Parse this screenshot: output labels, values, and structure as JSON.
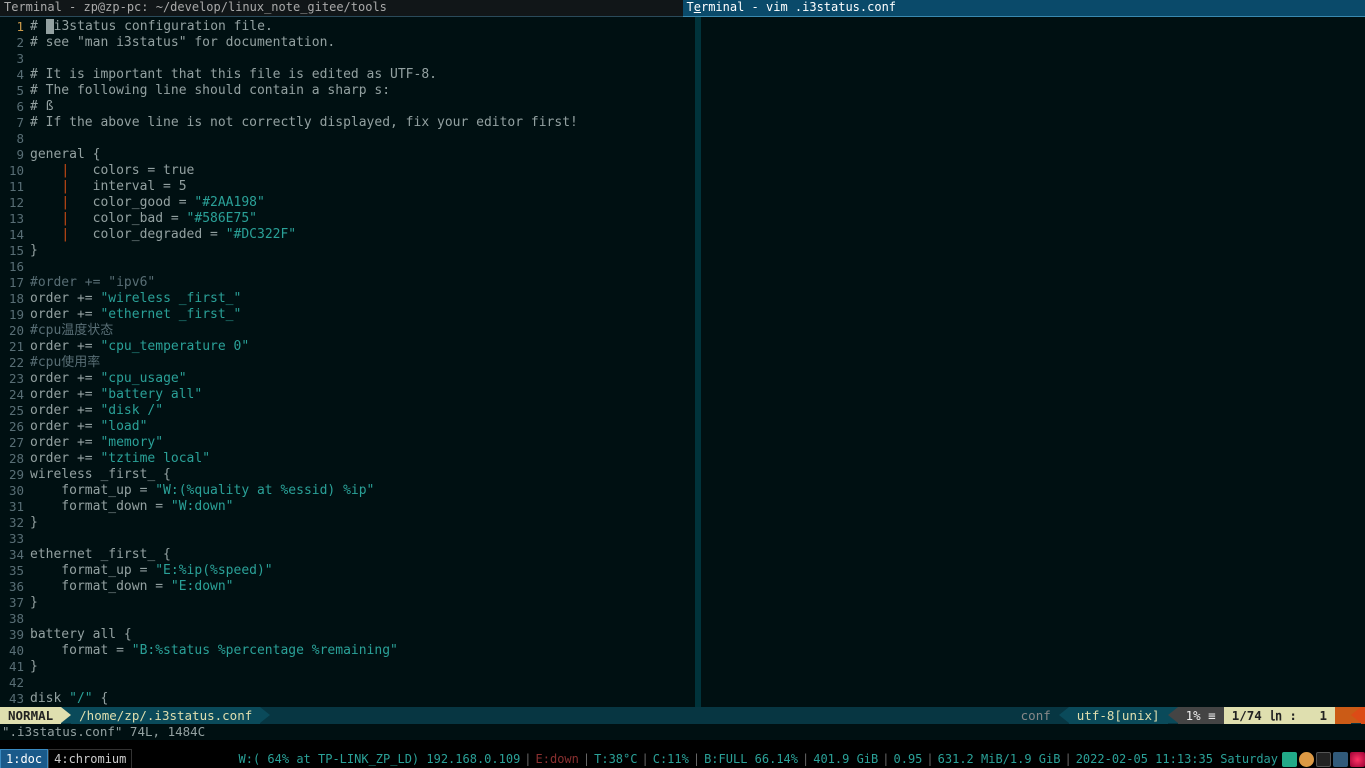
{
  "tabs": {
    "left": "Terminal - zp@zp-pc: ~/develop/linux_note_gitee/tools",
    "right_pre": "T",
    "right_u": "e",
    "right_post": "rminal - vim .i3status.conf"
  },
  "lines": [
    {
      "n": "1",
      "cur": true,
      "segs": [
        {
          "cls": "c-txt",
          "t": "# "
        },
        {
          "cls": "cursor-block",
          "t": ""
        },
        {
          "cls": "c-txt",
          "t": "i3status configuration file."
        }
      ]
    },
    {
      "n": "2",
      "segs": [
        {
          "cls": "c-txt",
          "t": "# see \"man i3status\" for documentation."
        }
      ]
    },
    {
      "n": "3",
      "segs": [
        {
          "cls": "c-txt",
          "t": ""
        }
      ]
    },
    {
      "n": "4",
      "segs": [
        {
          "cls": "c-txt",
          "t": "# It is important that this file is edited as UTF-8."
        }
      ]
    },
    {
      "n": "5",
      "segs": [
        {
          "cls": "c-txt",
          "t": "# The following line should contain a sharp s:"
        }
      ]
    },
    {
      "n": "6",
      "segs": [
        {
          "cls": "c-txt",
          "t": "# ß"
        }
      ]
    },
    {
      "n": "7",
      "segs": [
        {
          "cls": "c-txt",
          "t": "# If the above line is not correctly displayed, fix your editor first!"
        }
      ]
    },
    {
      "n": "8",
      "segs": [
        {
          "cls": "c-txt",
          "t": ""
        }
      ]
    },
    {
      "n": "9",
      "segs": [
        {
          "cls": "c-key",
          "t": "general {"
        }
      ]
    },
    {
      "n": "10",
      "segs": [
        {
          "cls": "c-txt",
          "t": "    "
        },
        {
          "cls": "c-bar",
          "t": "|"
        },
        {
          "cls": "c-txt",
          "t": "   colors = true"
        }
      ]
    },
    {
      "n": "11",
      "segs": [
        {
          "cls": "c-txt",
          "t": "    "
        },
        {
          "cls": "c-bar",
          "t": "|"
        },
        {
          "cls": "c-txt",
          "t": "   interval = 5"
        }
      ]
    },
    {
      "n": "12",
      "segs": [
        {
          "cls": "c-txt",
          "t": "    "
        },
        {
          "cls": "c-bar",
          "t": "|"
        },
        {
          "cls": "c-txt",
          "t": "   color_good = "
        },
        {
          "cls": "c-str",
          "t": "\"#2AA198\""
        }
      ]
    },
    {
      "n": "13",
      "segs": [
        {
          "cls": "c-txt",
          "t": "    "
        },
        {
          "cls": "c-bar",
          "t": "|"
        },
        {
          "cls": "c-txt",
          "t": "   color_bad = "
        },
        {
          "cls": "c-str",
          "t": "\"#586E75\""
        }
      ]
    },
    {
      "n": "14",
      "segs": [
        {
          "cls": "c-txt",
          "t": "    "
        },
        {
          "cls": "c-bar",
          "t": "|"
        },
        {
          "cls": "c-txt",
          "t": "   color_degraded = "
        },
        {
          "cls": "c-str",
          "t": "\"#DC322F\""
        }
      ]
    },
    {
      "n": "15",
      "segs": [
        {
          "cls": "c-key",
          "t": "}"
        }
      ]
    },
    {
      "n": "16",
      "segs": [
        {
          "cls": "c-txt",
          "t": ""
        }
      ]
    },
    {
      "n": "17",
      "segs": [
        {
          "cls": "c-comment",
          "t": "#order += \"ipv6\""
        }
      ]
    },
    {
      "n": "18",
      "segs": [
        {
          "cls": "c-txt",
          "t": "order += "
        },
        {
          "cls": "c-str",
          "t": "\"wireless _first_\""
        }
      ]
    },
    {
      "n": "19",
      "segs": [
        {
          "cls": "c-txt",
          "t": "order += "
        },
        {
          "cls": "c-str",
          "t": "\"ethernet _first_\""
        }
      ]
    },
    {
      "n": "20",
      "segs": [
        {
          "cls": "c-comment",
          "t": "#cpu温度状态"
        }
      ]
    },
    {
      "n": "21",
      "segs": [
        {
          "cls": "c-txt",
          "t": "order += "
        },
        {
          "cls": "c-str",
          "t": "\"cpu_temperature 0\""
        }
      ]
    },
    {
      "n": "22",
      "segs": [
        {
          "cls": "c-comment",
          "t": "#cpu使用率"
        }
      ]
    },
    {
      "n": "23",
      "segs": [
        {
          "cls": "c-txt",
          "t": "order += "
        },
        {
          "cls": "c-str",
          "t": "\"cpu_usage\""
        }
      ]
    },
    {
      "n": "24",
      "segs": [
        {
          "cls": "c-txt",
          "t": "order += "
        },
        {
          "cls": "c-str",
          "t": "\"battery all\""
        }
      ]
    },
    {
      "n": "25",
      "segs": [
        {
          "cls": "c-txt",
          "t": "order += "
        },
        {
          "cls": "c-str",
          "t": "\"disk /\""
        }
      ]
    },
    {
      "n": "26",
      "segs": [
        {
          "cls": "c-txt",
          "t": "order += "
        },
        {
          "cls": "c-str",
          "t": "\"load\""
        }
      ]
    },
    {
      "n": "27",
      "segs": [
        {
          "cls": "c-txt",
          "t": "order += "
        },
        {
          "cls": "c-str",
          "t": "\"memory\""
        }
      ]
    },
    {
      "n": "28",
      "segs": [
        {
          "cls": "c-txt",
          "t": "order += "
        },
        {
          "cls": "c-str",
          "t": "\"tztime local\""
        }
      ]
    },
    {
      "n": "29",
      "segs": [
        {
          "cls": "c-key",
          "t": "wireless _first_ {"
        }
      ]
    },
    {
      "n": "30",
      "segs": [
        {
          "cls": "c-txt",
          "t": "    format_up = "
        },
        {
          "cls": "c-str",
          "t": "\"W:(%quality at %essid) %ip\""
        }
      ]
    },
    {
      "n": "31",
      "segs": [
        {
          "cls": "c-txt",
          "t": "    format_down = "
        },
        {
          "cls": "c-str",
          "t": "\"W:down\""
        }
      ]
    },
    {
      "n": "32",
      "segs": [
        {
          "cls": "c-key",
          "t": "}"
        }
      ]
    },
    {
      "n": "33",
      "segs": [
        {
          "cls": "c-txt",
          "t": ""
        }
      ]
    },
    {
      "n": "34",
      "segs": [
        {
          "cls": "c-key",
          "t": "ethernet _first_ {"
        }
      ]
    },
    {
      "n": "35",
      "segs": [
        {
          "cls": "c-txt",
          "t": "    format_up = "
        },
        {
          "cls": "c-str",
          "t": "\"E:%ip(%speed)\""
        }
      ]
    },
    {
      "n": "36",
      "segs": [
        {
          "cls": "c-txt",
          "t": "    format_down = "
        },
        {
          "cls": "c-str",
          "t": "\"E:down\""
        }
      ]
    },
    {
      "n": "37",
      "segs": [
        {
          "cls": "c-key",
          "t": "}"
        }
      ]
    },
    {
      "n": "38",
      "segs": [
        {
          "cls": "c-txt",
          "t": ""
        }
      ]
    },
    {
      "n": "39",
      "segs": [
        {
          "cls": "c-key",
          "t": "battery all {"
        }
      ]
    },
    {
      "n": "40",
      "segs": [
        {
          "cls": "c-txt",
          "t": "    format = "
        },
        {
          "cls": "c-str",
          "t": "\"B:%status %percentage %remaining\""
        }
      ]
    },
    {
      "n": "41",
      "segs": [
        {
          "cls": "c-key",
          "t": "}"
        }
      ]
    },
    {
      "n": "42",
      "segs": [
        {
          "cls": "c-txt",
          "t": ""
        }
      ]
    },
    {
      "n": "43",
      "segs": [
        {
          "cls": "c-txt",
          "t": "disk "
        },
        {
          "cls": "c-str",
          "t": "\"/\""
        },
        {
          "cls": "c-key",
          "t": " {"
        }
      ]
    }
  ],
  "airline": {
    "mode": "NORMAL",
    "path": "/home/zp/.i3status.conf",
    "filetype": "conf",
    "encoding": "utf-8[unix]",
    "percent": "1%",
    "position": "1/74",
    "col_sep": ":",
    "col": "1"
  },
  "cmdline": "\".i3status.conf\" 74L, 1484C",
  "i3bar": {
    "ws1": "1:doc",
    "ws2": "4:chromium",
    "wifi": "W:( 64% at TP-LINK_ZP_LD) 192.168.0.109",
    "eth": "E:down",
    "temp": "T:38°C",
    "cpu": "C:11%",
    "batt": "B:FULL 66.14%",
    "disk": "401.9 GiB",
    "load": "0.95",
    "mem": "631.2 MiB/1.9 GiB",
    "time": "2022-02-05 11:13:35 Saturday"
  }
}
